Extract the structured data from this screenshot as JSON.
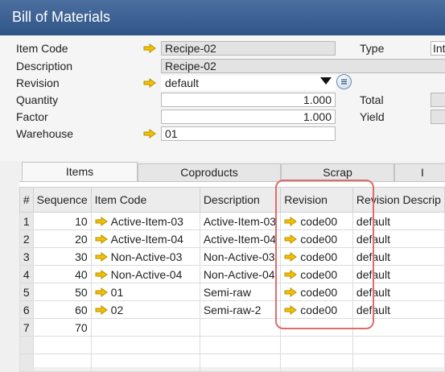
{
  "window": {
    "title": "Bill of Materials"
  },
  "form": {
    "item_code_label": "Item Code",
    "item_code": "Recipe-02",
    "description_label": "Description",
    "description": "Recipe-02",
    "revision_label": "Revision",
    "revision": "default",
    "quantity_label": "Quantity",
    "quantity": "1.000",
    "factor_label": "Factor",
    "factor": "1.000",
    "warehouse_label": "Warehouse",
    "warehouse": "01",
    "type_label": "Type",
    "type_value": "Int",
    "total_label": "Total",
    "yield_label": "Yield"
  },
  "tabs": [
    {
      "label": "Items",
      "active": true
    },
    {
      "label": "Coproducts"
    },
    {
      "label": "Scrap"
    },
    {
      "label": "I"
    }
  ],
  "grid": {
    "columns": [
      "#",
      "Sequence",
      "Item Code",
      "Description",
      "Revision",
      "Revision Descrip"
    ],
    "rows": [
      {
        "n": "1",
        "seq": "10",
        "code": "Active-Item-03",
        "desc": "Active-Item-03",
        "rev": "code00",
        "revdesc": "default"
      },
      {
        "n": "2",
        "seq": "20",
        "code": "Active-Item-04",
        "desc": "Active-Item-04",
        "rev": "code00",
        "revdesc": "default"
      },
      {
        "n": "3",
        "seq": "30",
        "code": "Non-Active-03",
        "desc": "Non-Active-03",
        "rev": "code00",
        "revdesc": "default"
      },
      {
        "n": "4",
        "seq": "40",
        "code": "Non-Active-04",
        "desc": "Non-Active-04",
        "rev": "code00",
        "revdesc": "default"
      },
      {
        "n": "5",
        "seq": "50",
        "code": "01",
        "desc": "Semi-raw",
        "rev": "code00",
        "revdesc": "default"
      },
      {
        "n": "6",
        "seq": "60",
        "code": "02",
        "desc": "Semi-raw-2",
        "rev": "code00",
        "revdesc": "default"
      },
      {
        "n": "7",
        "seq": "70",
        "code": "",
        "desc": "",
        "rev": "",
        "revdesc": ""
      }
    ]
  },
  "colors": {
    "titlebar": "#3a5f92",
    "link_arrow": "#e8b800",
    "highlight": "#e06b6b"
  },
  "icons": {
    "link": "link-arrow-icon",
    "dropdown": "dropdown-triangle-icon",
    "list": "list-button-icon"
  }
}
